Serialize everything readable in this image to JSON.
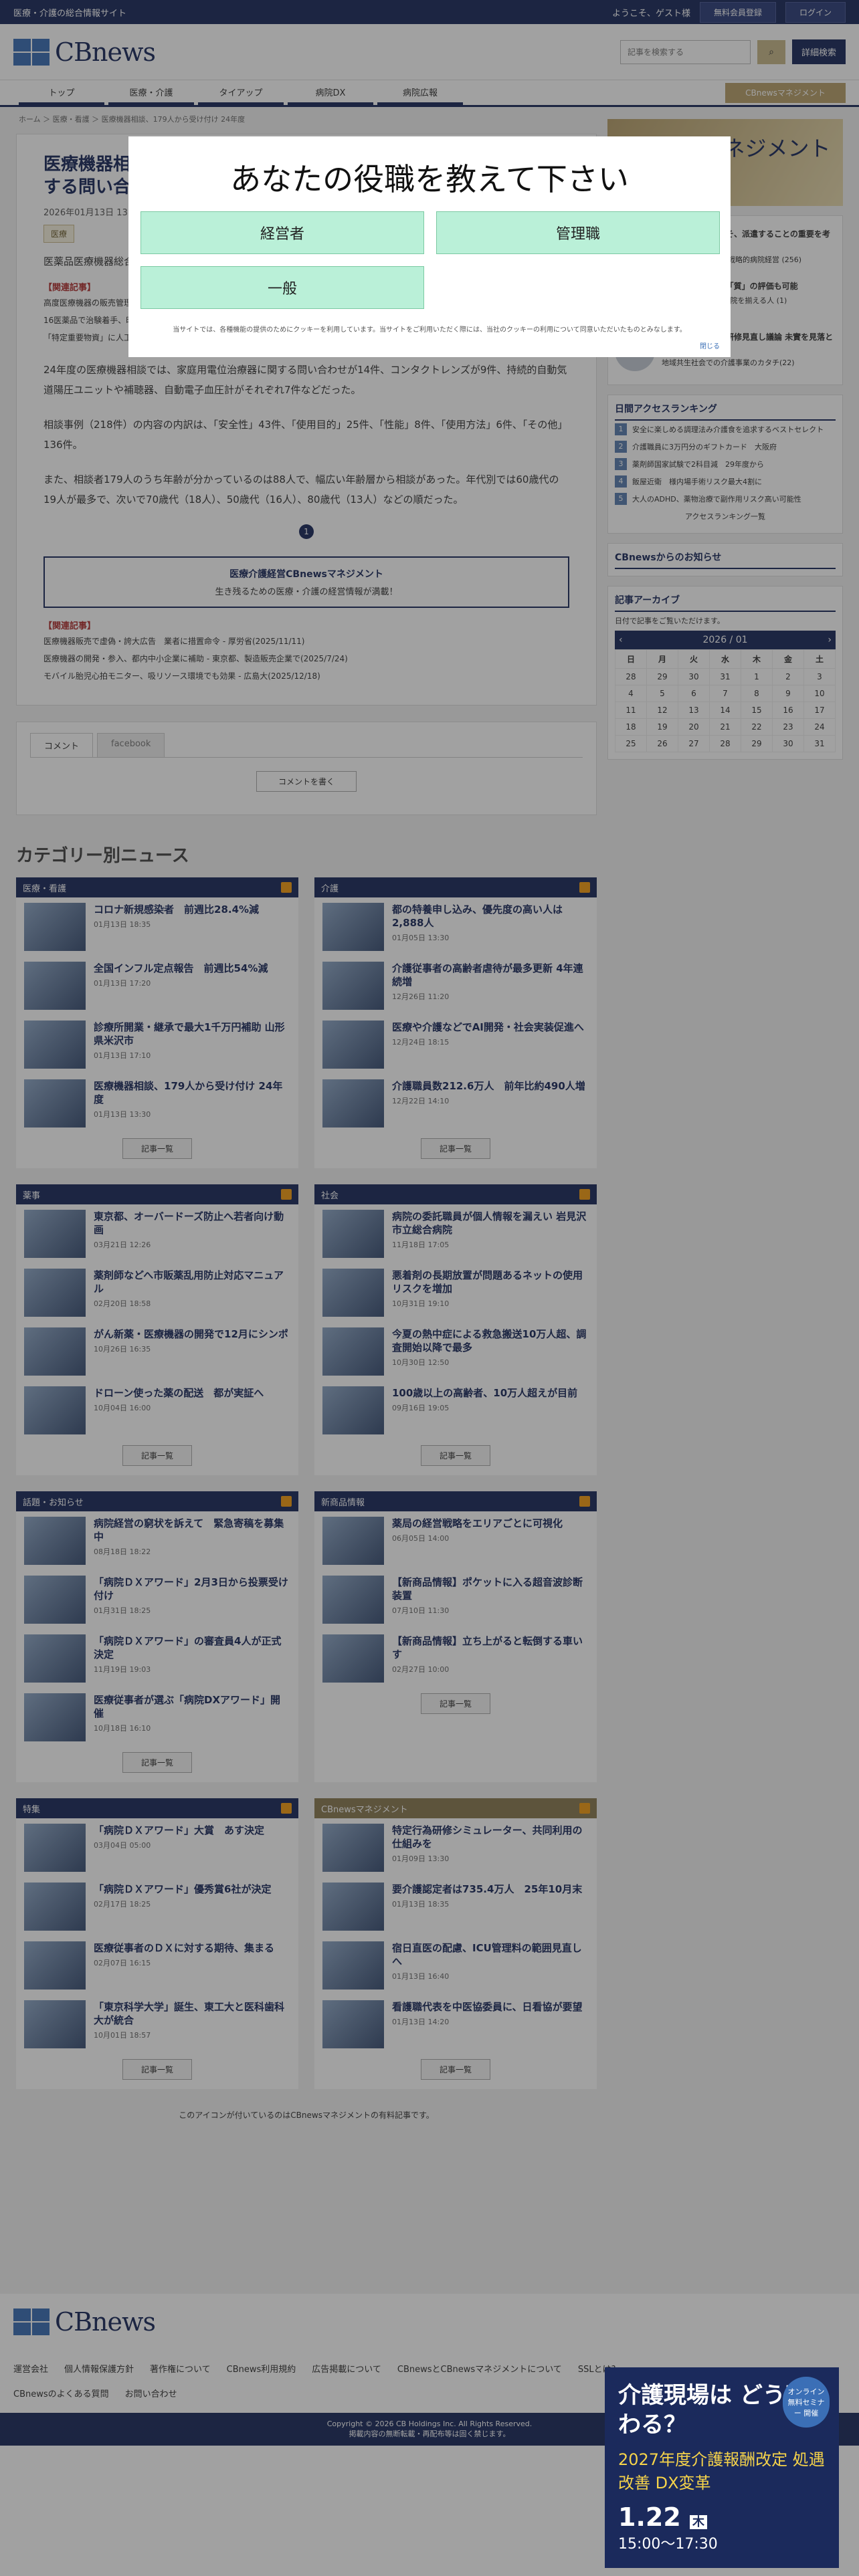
{
  "topbar": {
    "site": "医療・介護の総合情報サイト",
    "welcome": "ようこそ、ゲスト様",
    "register": "無料会員登録",
    "login": "ログイン"
  },
  "header": {
    "logo": "CBnews",
    "search_placeholder": "記事を検索する",
    "advanced": "詳細検索"
  },
  "nav": {
    "tabs": [
      "トップ",
      "医療・介護",
      "タイアップ",
      "病院DX",
      "病院広報"
    ],
    "mgmt": "CBnewsマネジメント"
  },
  "breadcrumb": "ホーム ＞ 医療・看護 ＞ 医療機器相談、179人から受け付け 24年度",
  "article": {
    "title": "医療機器相談、179人から受け付け 24年度 家庭用電位治療器に関する問い合わせが最多",
    "date": "2026年01月13日 13:30",
    "tag": "医療",
    "lead": "医薬品医療機器総合機構（PMDA）は、2024年度に医療機器相談で179人から受け付けた相談内容をまとめた。",
    "rel_h": "【関連記事】",
    "rel": [
      "高度医療機器の販売管理者向け講習を実施 (2025/10/20)",
      "16医薬品で治験着手、昨年度の制度見直し受け・3団体調査　企業の行動変容を評価する声も (2025/7/10)",
      "「特定重要物資」に人工呼吸器を追加へ・99%を輸入に依存　供給確保の取組方針案を公表(2025/12/9)"
    ],
    "p1": "24年度の医療機器相談では、家庭用電位治療器に関する問い合わせが14件、コンタクトレンズが9件、持続的自動気道陽圧ユニットや補聴器、自動電子血圧計がそれぞれ7件などだった。",
    "p2": "相談事例（218件）の内容の内訳は、「安全性」43件、「使用目的」25件、「性能」8件、「使用方法」6件、「その他」136件。",
    "p3": "また、相談者179人のうち年齢が分かっているのは88人で、幅広い年齢層から相談があった。年代別では60歳代の19人が最多で、次いで70歳代（18人）、50歳代（16人）、80歳代（13人）などの順だった。",
    "page": "1",
    "banner1": "医療介護経営CBnewsマネジメント",
    "banner2": "生き残るための医療・介護の経営情報が満載！",
    "rel2": [
      "医療機器販売で虚偽・誇大広告　業者に措置命令 - 厚労省(2025/11/11)",
      "医療機器の開発・参入、都内中小企業に補助 - 東京都、製造販売企業で(2025/7/24)",
      "モバイル胎児心拍モニター、吸リソース環境でも効果 - 広島大(2025/12/18)"
    ]
  },
  "comment": {
    "tab1": "コメント",
    "tab2": "facebook",
    "btn": "コメントを書く"
  },
  "categories_title": "カテゴリー別ニュース",
  "categories": [
    {
      "name": "医療・看護",
      "items": [
        {
          "t": "コロナ新規感染者　前週比28.4%減",
          "d": "01月13日 18:35"
        },
        {
          "t": "全国インフル定点報告　前週比54%減",
          "d": "01月13日 17:20"
        },
        {
          "t": "診療所開業・継承で最大1千万円補助 山形県米沢市",
          "d": "01月13日 17:10"
        },
        {
          "t": "医療機器相談、179人から受け付け 24年度",
          "d": "01月13日 13:30"
        }
      ]
    },
    {
      "name": "介護",
      "items": [
        {
          "t": "都の特養申し込み、優先度の高い人は2,888人",
          "d": "01月05日 13:30"
        },
        {
          "t": "介護従事者の高齢者虐待が最多更新 4年連続増",
          "d": "12月26日 11:20"
        },
        {
          "t": "医療や介護などでAI開発・社会実装促進へ",
          "d": "12月24日 18:15"
        },
        {
          "t": "介護職員数212.6万人　前年比約490人増",
          "d": "12月22日 14:10"
        }
      ]
    },
    {
      "name": "薬事",
      "items": [
        {
          "t": "東京都、オーバードーズ防止へ若者向け動画",
          "d": "03月21日 12:26"
        },
        {
          "t": "薬剤師などへ市販薬乱用防止対応マニュアル",
          "d": "02月20日 18:58"
        },
        {
          "t": "がん新薬・医療機器の開発で12月にシンポ",
          "d": "10月26日 16:35"
        },
        {
          "t": "ドローン使った薬の配送　都が実証へ",
          "d": "10月04日 16:00"
        }
      ]
    },
    {
      "name": "社会",
      "items": [
        {
          "t": "病院の委託職員が個人情報を漏えい 岩見沢市立総合病院",
          "d": "11月18日 17:05"
        },
        {
          "t": "悪着剤の長期放置が問題あるネットの使用リスクを増加",
          "d": "10月31日 19:10"
        },
        {
          "t": "今夏の熱中症による救急搬送10万人超、調査開始以降で最多",
          "d": "10月30日 12:50"
        },
        {
          "t": "100歳以上の高齢者、10万人超えが目前",
          "d": "09月16日 19:05"
        }
      ]
    },
    {
      "name": "話題・お知らせ",
      "items": [
        {
          "t": "病院経営の窮状を訴えて　緊急寄稿を募集中",
          "d": "08月18日 18:22"
        },
        {
          "t": "「病院ＤＸアワード」2月3日から投票受け付け",
          "d": "01月31日 18:25"
        },
        {
          "t": "「病院ＤＸアワード」の審査員4人が正式決定",
          "d": "11月19日 19:03"
        },
        {
          "t": "医療従事者が選ぶ「病院DXアワード」開催",
          "d": "10月18日 16:10"
        }
      ]
    },
    {
      "name": "新商品情報",
      "items": [
        {
          "t": "薬局の経営戦略をエリアごとに可視化",
          "d": "06月05日 14:00"
        },
        {
          "t": "【新商品情報】ポケットに入る超音波診断装置",
          "d": "07月10日 11:30"
        },
        {
          "t": "【新商品情報】立ち上がると転倒する車いす",
          "d": "02月27日 10:00"
        }
      ]
    },
    {
      "name": "特集",
      "items": [
        {
          "t": "「病院ＤＸアワード」大賞　あす決定",
          "d": "03月04日 05:00"
        },
        {
          "t": "「病院ＤＸアワード」優秀賞6社が決定",
          "d": "02月17日 18:25"
        },
        {
          "t": "医療従事者のＤＸに対する期待、集まる",
          "d": "02月07日 16:15"
        },
        {
          "t": "「東京科学大学」誕生、東工大と医科歯科大が統合",
          "d": "10月01日 18:57"
        }
      ]
    },
    {
      "name": "CBnewsマネジメント",
      "items": [
        {
          "t": "特定行為研修シミュレーター、共同利用の仕組みを",
          "d": "01月09日 13:30"
        },
        {
          "t": "要介護認定者は735.4万人　25年10月末",
          "d": "01月13日 18:35"
        },
        {
          "t": "宿日直医の配慮、ICU管理料の範囲見直しへ",
          "d": "01月13日 16:40"
        },
        {
          "t": "看護職代表を中医協委員に、日看協が要望",
          "d": "01月13日 14:20"
        }
      ]
    }
  ],
  "more": "記事一覧",
  "note": "このアイコンが付いているのはCBnewsマネジメントの有料記事です。",
  "side": {
    "ad": "CBnews マネジメント 購読する",
    "news": [
      {
        "t": "人は財産だからこそ、派遣することの重要を考える",
        "s": "先が見えない時代の戦略的病院経営 (256)"
      },
      {
        "t": "看護必要度による「質」の評価も可能",
        "s": "名院は立ち上がる 名院を揃える人 (1)"
      },
      {
        "t": "ケアマネの更新・研修見直し議論 未實を見落とすな",
        "s": "地域共生社会での介護事業のカタチ(22)"
      }
    ],
    "rank_h": "日間アクセスランキング",
    "ranks": [
      "安全に楽しめる調理法み介護食を追求するベストセレクト",
      "介護職員に3万円分のギフトカード　大阪府",
      "薬剤師国家試験で2科目減　29年度から",
      "飯屋近衛　様内場手術リスク最大4割に",
      "大人のADHD、薬物治療で副作用リスク高い可能性"
    ],
    "rank_more": "アクセスランキング一覧",
    "notice": "CBnewsからのお知らせ",
    "archive": "記事アーカイブ",
    "archive_sub": "日付で記事をご覧いただけます。",
    "month": "2026 / 01",
    "week": [
      "日",
      "月",
      "火",
      "水",
      "木",
      "金",
      "土"
    ],
    "days": [
      "28",
      "29",
      "30",
      "31",
      "1",
      "2",
      "3",
      "4",
      "5",
      "6",
      "7",
      "8",
      "9",
      "10",
      "11",
      "12",
      "13",
      "14",
      "15",
      "16",
      "17",
      "18",
      "19",
      "20",
      "21",
      "22",
      "23",
      "24",
      "25",
      "26",
      "27",
      "28",
      "29",
      "30",
      "31"
    ]
  },
  "footer": {
    "links": [
      "運営会社",
      "個人情報保護方針",
      "著作権について",
      "CBnews利用規約",
      "広告掲載について",
      "CBnewsとCBnewsマネジメントについて"
    ],
    "faq": "CBnewsのよくある質問",
    "contact": "お問い合わせ",
    "copy": "Copyright © 2026 CB Holdings Inc. All Rights Reserved.",
    "copy2": "掲載内容の無断転載・再配布等は固く禁じます。",
    "ssl": "SSLとは?"
  },
  "popad": {
    "h1": "介護現場は どう変わる？",
    "h2": "2027年度介護報酬改定 処遇改善 DX変革",
    "date": "1.22",
    "day": "木",
    "time": "15:00〜17:30",
    "badge": "オンライン 無料セミナー 開催"
  },
  "modal": {
    "title": "あなたの役職を教えて下さい",
    "roles": [
      "経営者",
      "管理職",
      "一般"
    ],
    "foot": "当サイトでは、各種機能の提供のためにクッキーを利用しています。当サイトをご利用いただく際には、当社のクッキーの利用について同意いただいたものとみなします。",
    "close": "閉じる"
  }
}
